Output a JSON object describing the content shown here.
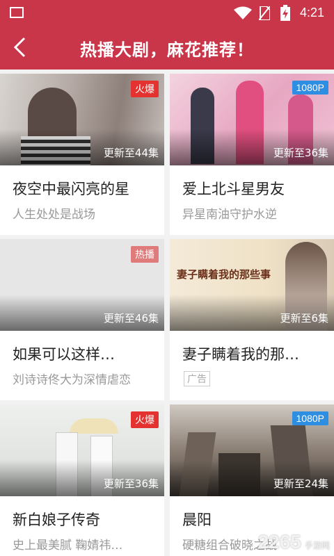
{
  "status_bar": {
    "time": "4:21"
  },
  "header": {
    "title": "热播大剧，麻花推荐！"
  },
  "cards": [
    {
      "name": "夜空中最闪亮的星",
      "desc": "人生处处是战场",
      "update": "更新至44集",
      "badge": "火爆",
      "badge_type": "hot"
    },
    {
      "name": "爱上北斗星男友",
      "desc": "异星南油守护水逆",
      "update": "更新至36集",
      "badge": "1080P",
      "badge_type": "hd"
    },
    {
      "name": "如果可以这样…",
      "desc": "刘诗诗佟大为深情虐恋",
      "update": "更新至46集",
      "badge": "热播",
      "badge_type": "airing"
    },
    {
      "name": "妻子瞒着我的那…",
      "desc": "",
      "ad_label": "广告",
      "update": "更新至6集",
      "thumb_text": "妻子瞒着我的那些事"
    },
    {
      "name": "新白娘子传奇",
      "desc": "史上最美腻 鞠婧祎…",
      "update": "更新至36集",
      "badge": "火爆",
      "badge_type": "hot"
    },
    {
      "name": "晨阳",
      "desc": "硬糖组合破晓之战",
      "update": "更新至24集",
      "badge": "1080P",
      "badge_type": "hd"
    }
  ],
  "watermark": {
    "number": "2265",
    "text": "手游网"
  },
  "colors": {
    "header_bg": "#c9364a",
    "hot_badge": "#e3322f",
    "hd_badge": "#2d8ee2"
  }
}
